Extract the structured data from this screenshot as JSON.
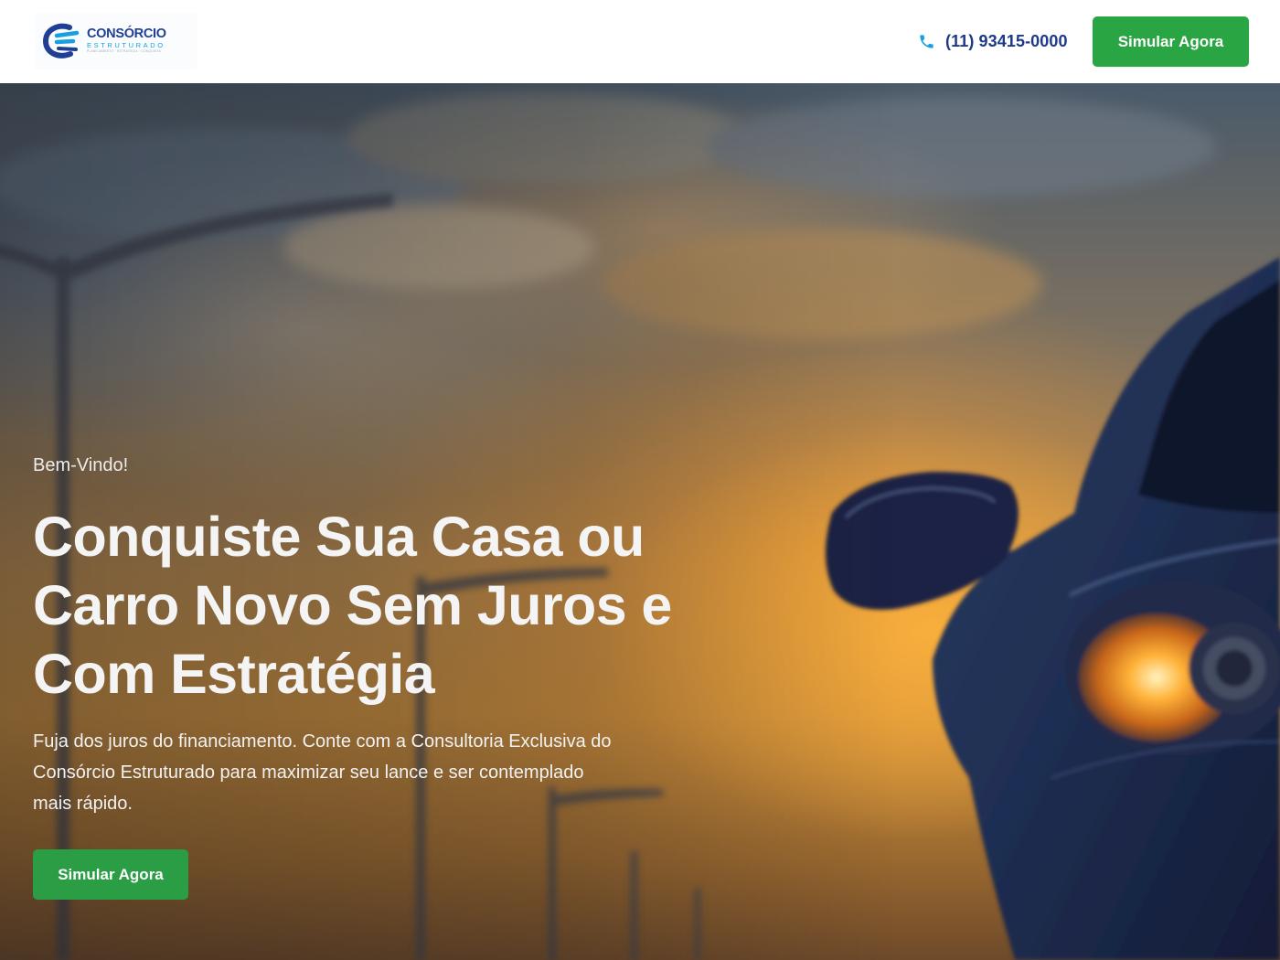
{
  "header": {
    "logo": {
      "title": "CONSÓRCIO",
      "subtitle": "ESTRUTURADO",
      "tagline": "PLANEJAMENTO · ESTRATÉGIA · CONQUISTA"
    },
    "phone": "(11) 93415-0000",
    "cta_label": "Simular Agora"
  },
  "hero": {
    "eyebrow": "Bem-Vindo!",
    "title": "Conquiste Sua Casa ou Carro Novo Sem Juros e Com Estratégia",
    "description": "Fuja dos juros do financiamento. Conte com a Consultoria Exclusiva do Consórcio Estruturado para maximizar seu lance e ser contemplado mais rápido.",
    "cta_label": "Simular Agora"
  },
  "colors": {
    "brand_blue": "#1f3f95",
    "brand_light_blue": "#17a0e0",
    "cta_green": "#2aa544",
    "phone_icon": "#17a0e0"
  },
  "icons": {
    "phone": "phone-icon",
    "logo_mark": "consorcio-logo-icon"
  }
}
